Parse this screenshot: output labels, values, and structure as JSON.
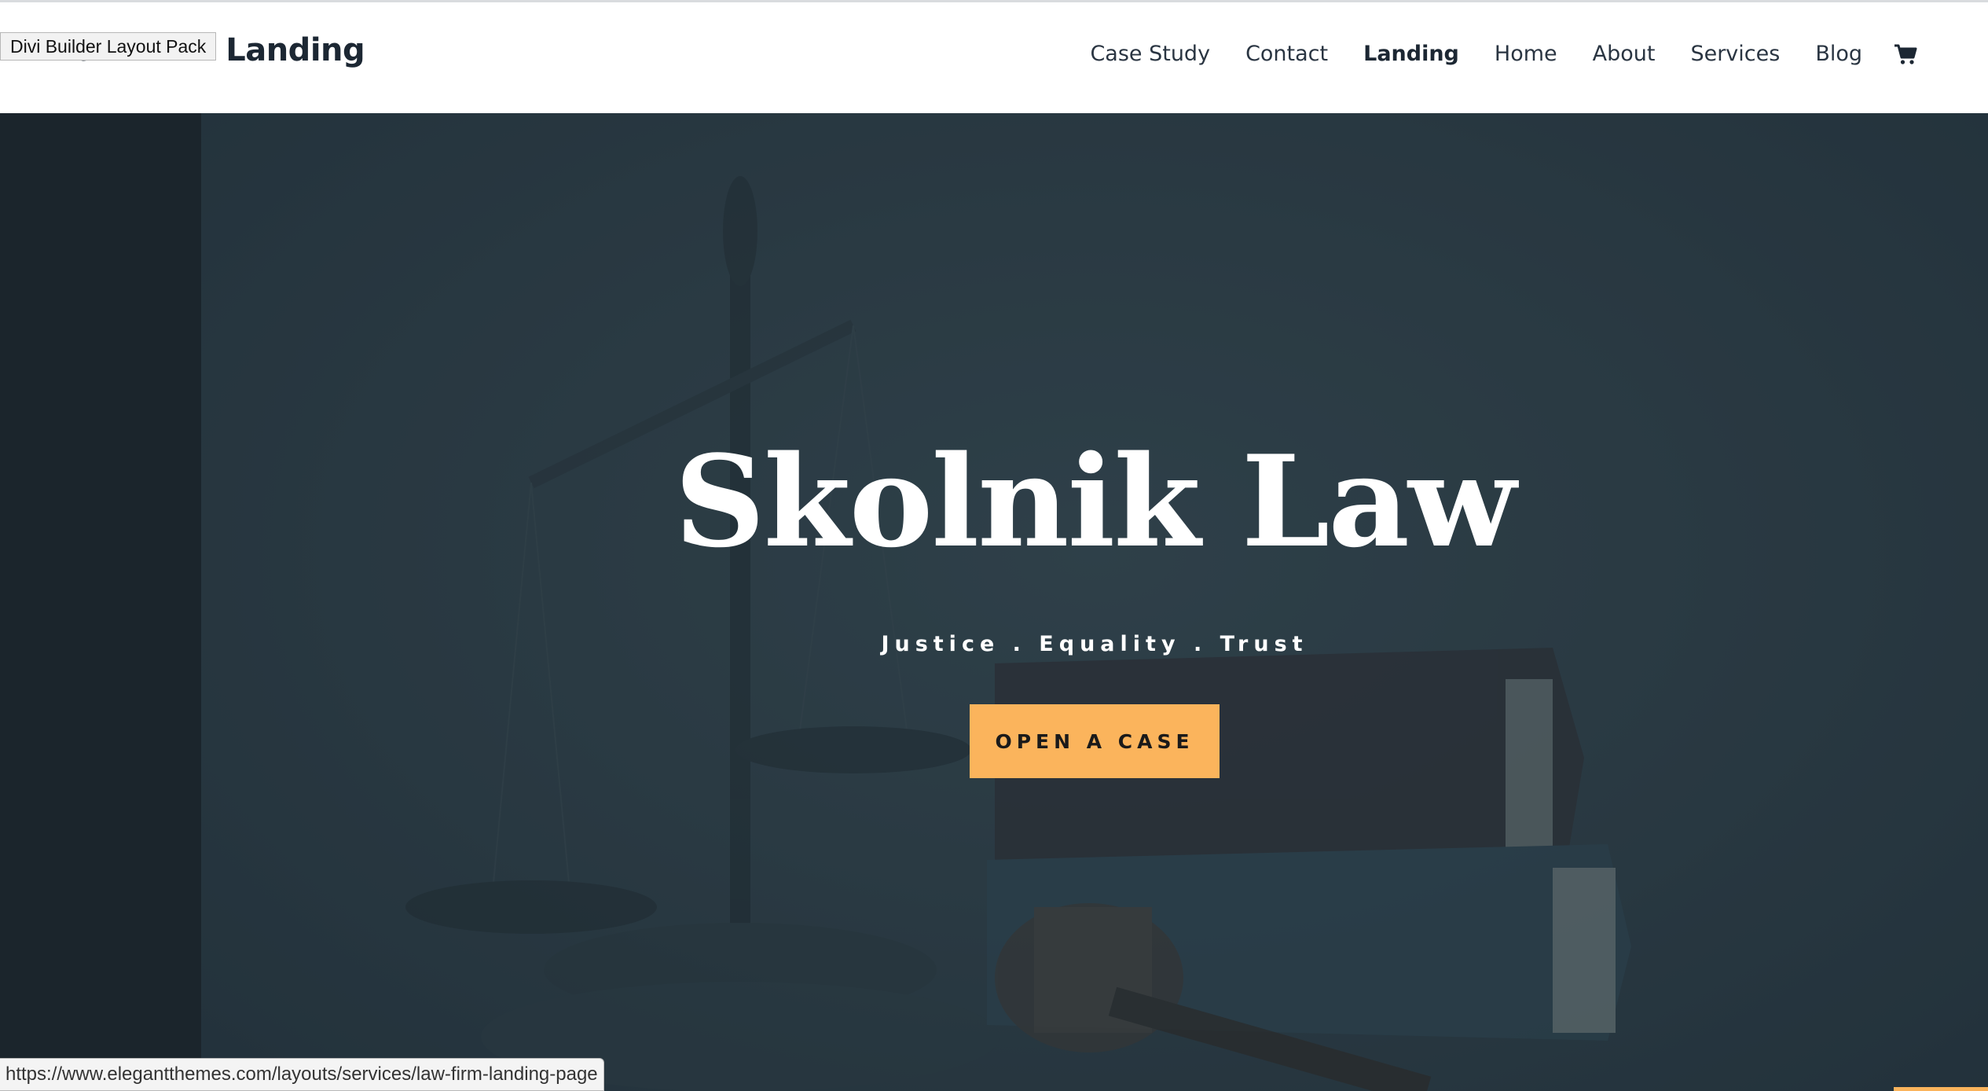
{
  "browser": {
    "tooltip": "Divi Builder Layout Pack",
    "status_url": "https://www.elegantthemes.com/layouts/services/law-firm-landing-page"
  },
  "header": {
    "site_title": "Law Firm Landing",
    "nav": [
      {
        "label": "Case Study",
        "active": false
      },
      {
        "label": "Contact",
        "active": false
      },
      {
        "label": "Landing",
        "active": true
      },
      {
        "label": "Home",
        "active": false
      },
      {
        "label": "About",
        "active": false
      },
      {
        "label": "Services",
        "active": false
      },
      {
        "label": "Blog",
        "active": false
      }
    ],
    "cart_icon": "shopping-cart-icon"
  },
  "hero": {
    "title": "Skolnik Law",
    "tagline": "Justice . Equality . Trust",
    "cta_label": "OPEN A CASE",
    "background_image": "scales-of-justice-books-gavel",
    "accent_color": "#fbb45c"
  }
}
